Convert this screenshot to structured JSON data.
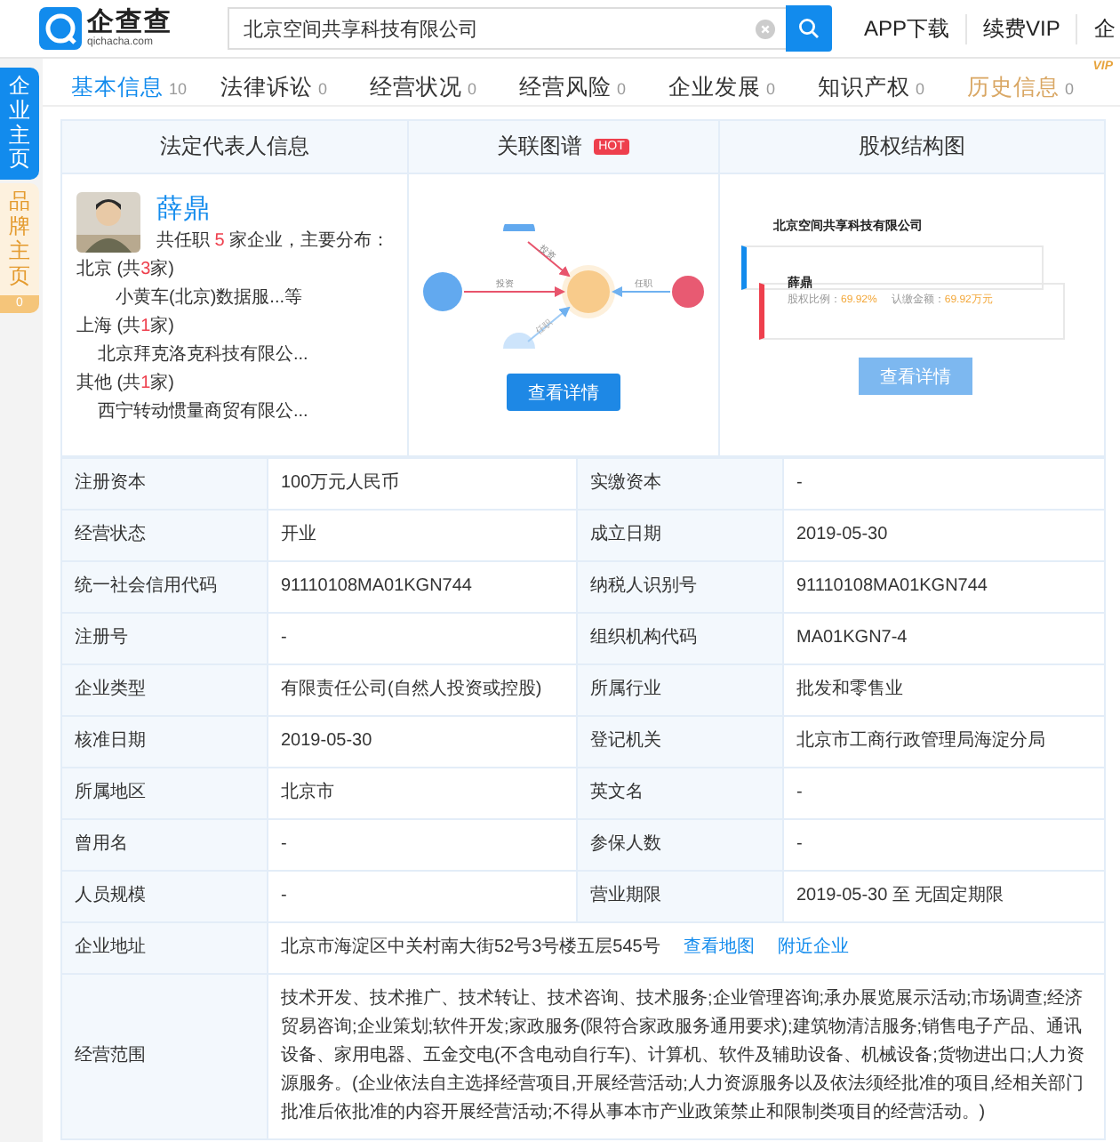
{
  "header": {
    "brand": "企查查",
    "domain": "qichacha.com",
    "search_value": "北京空间共享科技有限公司",
    "links": [
      "APP下载",
      "续费VIP",
      "企"
    ]
  },
  "side_tabs": [
    {
      "label": "企业主页",
      "selected": true
    },
    {
      "label": "品牌主页",
      "selected": false,
      "count": "0"
    }
  ],
  "tabs": [
    {
      "label": "基本信息",
      "count": "10",
      "selected": true,
      "kind": "normal"
    },
    {
      "label": "法律诉讼",
      "count": "0",
      "selected": false,
      "kind": "normal"
    },
    {
      "label": "经营状况",
      "count": "0",
      "selected": false,
      "kind": "normal"
    },
    {
      "label": "经营风险",
      "count": "0",
      "selected": false,
      "kind": "normal"
    },
    {
      "label": "企业发展",
      "count": "0",
      "selected": false,
      "kind": "normal"
    },
    {
      "label": "知识产权",
      "count": "0",
      "selected": false,
      "kind": "normal"
    },
    {
      "label": "历史信息",
      "count": "0",
      "selected": false,
      "kind": "vip",
      "badge": "VIP"
    }
  ],
  "summary": {
    "legal_title": "法定代表人信息",
    "graph_title": "关联图谱",
    "graph_badge": "HOT",
    "equity_title": "股权结构图",
    "person": {
      "name": "薛鼎",
      "text_before": "共任职",
      "count": "5",
      "text_after": "家企业，主要分布："
    },
    "regions": [
      {
        "prefix": "北京 (共",
        "count": "3",
        "suffix": "家)",
        "company": "小黄车(北京)数据服...等"
      },
      {
        "prefix": "上海 (共",
        "count": "1",
        "suffix": "家)",
        "company": "北京拜克洛克科技有限公..."
      },
      {
        "prefix": "其他 (共",
        "count": "1",
        "suffix": "家)",
        "company": "西宁转动惯量商贸有限公..."
      }
    ],
    "graph_labels": [
      "投资",
      "投资",
      "任职",
      "任职"
    ],
    "graph_button": "查看详情",
    "equity": {
      "company": "北京空间共享科技有限公司",
      "holder": "薛鼎",
      "ratio_label": "股权比例：",
      "ratio": "69.92%",
      "amount_label": "认缴金额：",
      "amount": "69.92万元",
      "button": "查看详情"
    }
  },
  "table": {
    "rows": [
      {
        "kind": "pair",
        "cells": [
          "注册资本",
          "100万元人民币",
          "实缴资本",
          "-"
        ]
      },
      {
        "kind": "pair",
        "cells": [
          "经营状态",
          "开业",
          "成立日期",
          "2019-05-30"
        ]
      },
      {
        "kind": "pair",
        "cells": [
          "统一社会信用代码",
          "91110108MA01KGN744",
          "纳税人识别号",
          "91110108MA01KGN744"
        ]
      },
      {
        "kind": "pair",
        "cells": [
          "注册号",
          "-",
          "组织机构代码",
          "MA01KGN7-4"
        ]
      },
      {
        "kind": "pair",
        "cells": [
          "企业类型",
          "有限责任公司(自然人投资或控股)",
          "所属行业",
          "批发和零售业"
        ]
      },
      {
        "kind": "pair",
        "cells": [
          "核准日期",
          "2019-05-30",
          "登记机关",
          "北京市工商行政管理局海淀分局"
        ]
      },
      {
        "kind": "pair",
        "cells": [
          "所属地区",
          "北京市",
          "英文名",
          "-"
        ]
      },
      {
        "kind": "pair",
        "cells": [
          "曾用名",
          "-",
          "参保人数",
          "-"
        ]
      },
      {
        "kind": "pair",
        "cells": [
          "人员规模",
          "-",
          "营业期限",
          "2019-05-30 至 无固定期限"
        ]
      },
      {
        "kind": "address",
        "cells": [
          "企业地址",
          "北京市海淀区中关村南大街52号3号楼五层545号"
        ],
        "links": [
          "查看地图",
          "附近企业"
        ]
      },
      {
        "kind": "wide",
        "cells": [
          "经营范围",
          "技术开发、技术推广、技术转让、技术咨询、技术服务;企业管理咨询;承办展览展示活动;市场调查;经济贸易咨询;企业策划;软件开发;家政服务(限符合家政服务通用要求);建筑物清洁服务;销售电子产品、通讯设备、家用电器、五金交电(不含电动自行车)、计算机、软件及辅助设备、机械设备;货物进出口;人力资源服务。(企业依法自主选择经营项目,开展经营活动;人力资源服务以及依法须经批准的项目,经相关部门批准后依批准的内容开展经营活动;不得从事本市产业政策禁止和限制类项目的经营活动。)"
        ]
      }
    ]
  }
}
